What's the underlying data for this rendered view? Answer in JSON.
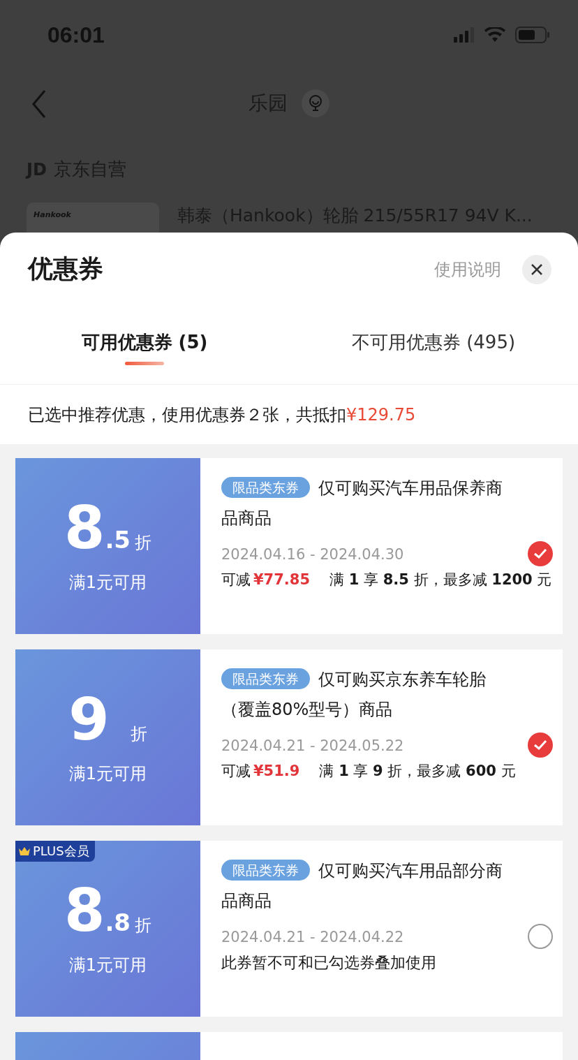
{
  "status_bar": {
    "time": "06:01"
  },
  "nav": {
    "title": "乐园"
  },
  "shop": {
    "logo": "JD",
    "name": "京东自营"
  },
  "product": {
    "brand_logo": "Hankook",
    "title": "韩泰（Hankook）轮胎 215/55R17 94V K..."
  },
  "sheet": {
    "title": "优惠券",
    "help": "使用说明"
  },
  "tabs": [
    {
      "label": "可用优惠券 (5)",
      "selected": true
    },
    {
      "label": "不可用优惠券 (495)",
      "selected": false
    }
  ],
  "summary": {
    "text": "已选中推荐优惠，使用优惠券２张，共抵扣",
    "amount": "¥129.75"
  },
  "coupons": [
    {
      "kind": "savings",
      "major": "8",
      "minor": ".5",
      "unit": "折",
      "condition": "满1元可用",
      "tag": "限品类东券",
      "title": "仅可购买汽车用品保养商品商品",
      "dates": "2024.04.16 - 2024.04.30",
      "save_label": "可减",
      "save_amount": "¥77.85",
      "rule": "满 **1** 享 **8.5** 折，最多减 **1200** 元",
      "selected": true
    },
    {
      "kind": "savings",
      "major": "9",
      "unit": "折",
      "condition": "满1元可用",
      "tag": "限品类东券",
      "title": "仅可购买京东养车轮胎（覆盖80%型号）商品",
      "dates": "2024.04.21 - 2024.05.22",
      "save_label": "可减",
      "save_amount": "¥51.9",
      "rule": "满 **1** 享 **9** 折，最多减 **600** 元",
      "selected": true
    },
    {
      "kind": "note",
      "badge": "PLUS会员",
      "major": "8",
      "minor": ".8",
      "unit": "折",
      "condition": "满1元可用",
      "tag": "限品类东券",
      "title": "仅可购买汽车用品部分商品商品",
      "dates": "2024.04.21 - 2024.04.22",
      "note": "此券暂不可和已勾选券叠加使用",
      "selected": false
    },
    {
      "kind": "stub"
    }
  ]
}
